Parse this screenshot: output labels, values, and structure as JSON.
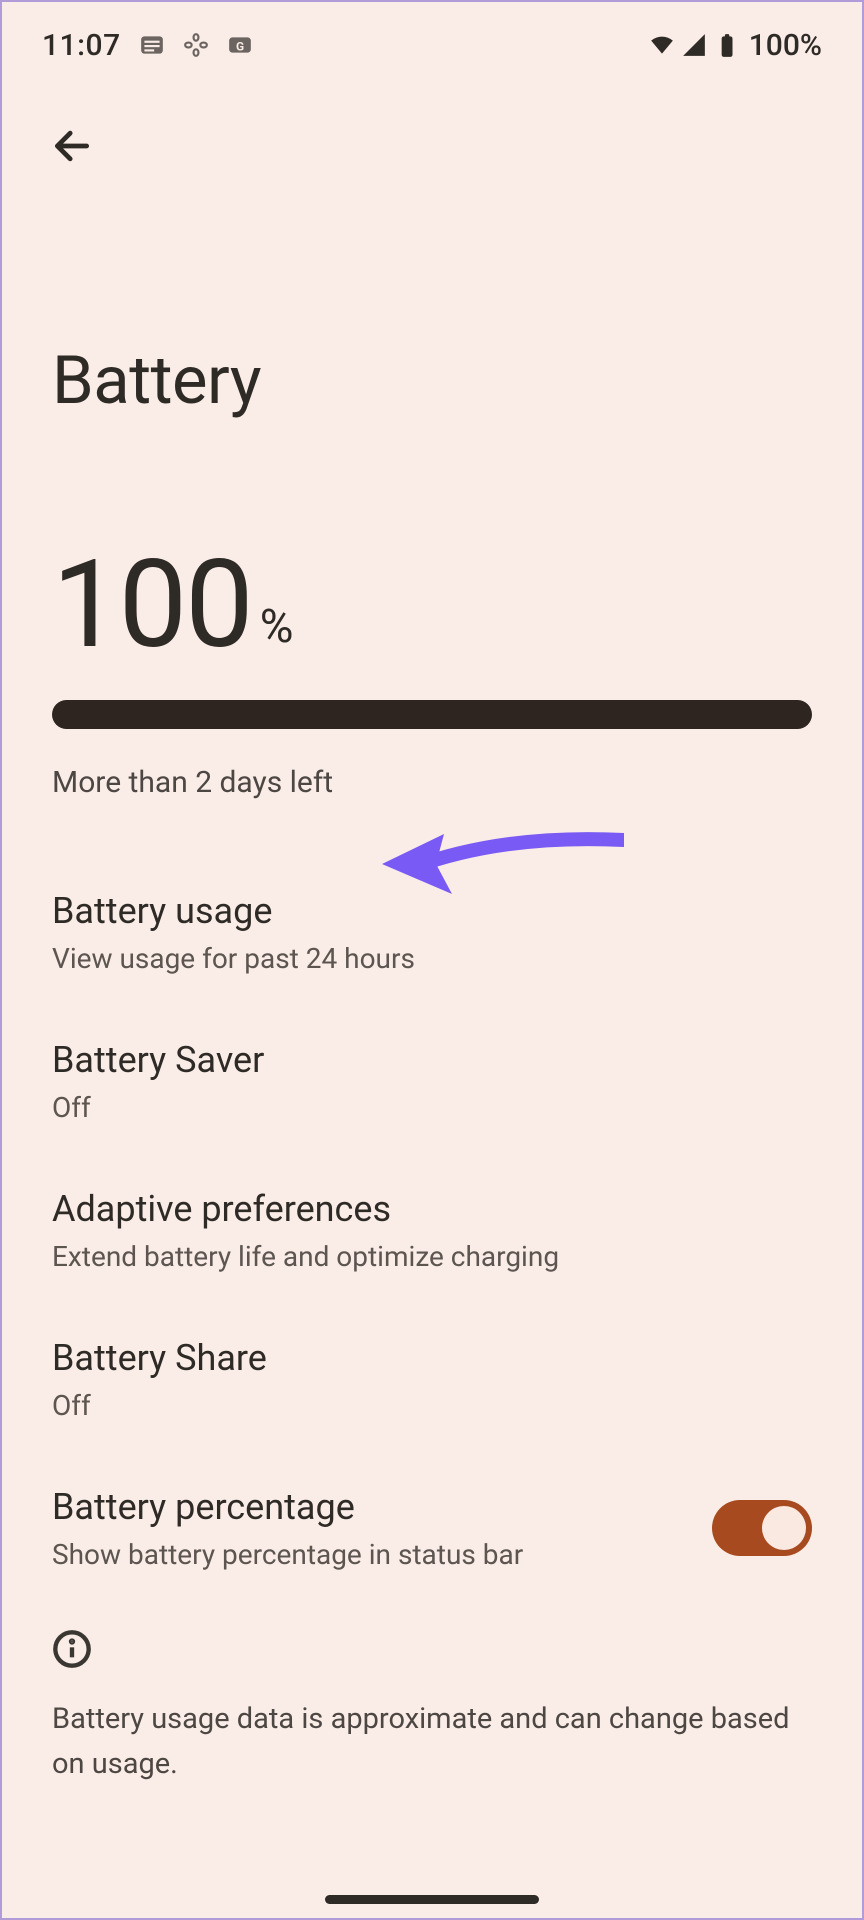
{
  "status": {
    "time": "11:07",
    "battery_text": "100%"
  },
  "toolbar": {
    "back": "Back"
  },
  "page": {
    "title": "Battery"
  },
  "hero": {
    "value": "100",
    "unit": "%",
    "progress_pct": 100,
    "estimate": "More than 2 days left"
  },
  "items": [
    {
      "title": "Battery usage",
      "subtitle": "View usage for past 24 hours"
    },
    {
      "title": "Battery Saver",
      "subtitle": "Off"
    },
    {
      "title": "Adaptive preferences",
      "subtitle": "Extend battery life and optimize charging"
    },
    {
      "title": "Battery Share",
      "subtitle": "Off"
    },
    {
      "title": "Battery percentage",
      "subtitle": "Show battery percentage in status bar",
      "toggle": true
    }
  ],
  "info": {
    "text": "Battery usage data is approximate and can change based on usage."
  },
  "annotation": {
    "arrow_color": "#7a5af5",
    "points_to": "Battery usage"
  }
}
